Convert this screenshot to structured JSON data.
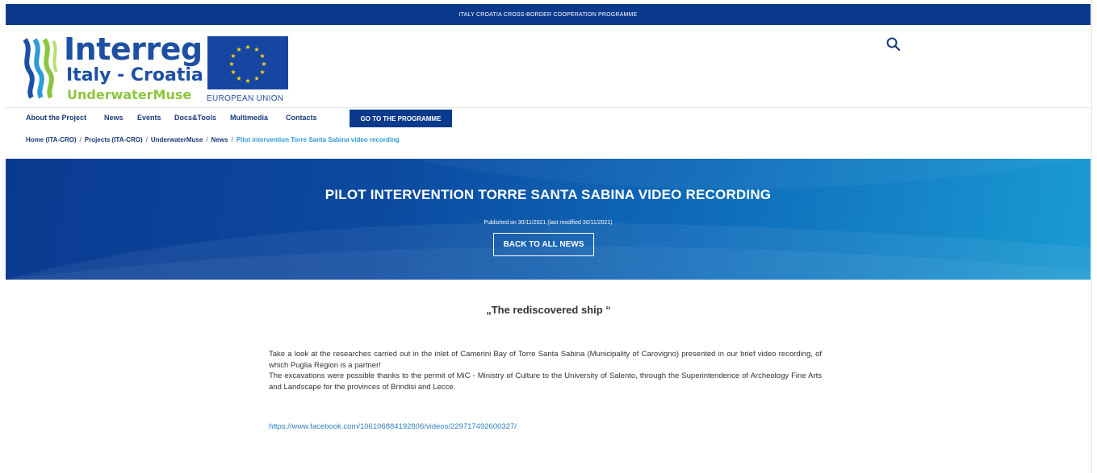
{
  "topbar": {
    "text": "ITALY CROATIA CROSS-BORDER COOPERATION PROGRAMME"
  },
  "logo": {
    "line1": "Interreg",
    "line2": "Italy - Croatia",
    "line3": "UnderwaterMuse",
    "eu_label": "EUROPEAN UNION",
    "colors": {
      "blue": "#1d4fa3",
      "green": "#8cc63f",
      "eu_flag": "#1746a2",
      "stars": "#ffdd00"
    }
  },
  "search": {
    "icon": "search-icon"
  },
  "nav": {
    "items": [
      "About the Project",
      "News",
      "Events",
      "Docs&Tools",
      "Multimedia",
      "Contacts"
    ],
    "program_button": "GO TO THE PROGRAMME"
  },
  "breadcrumb": {
    "items": [
      "Home (ITA-CRO)",
      "Projects (ITA-CRO)",
      "UnderwaterMuse",
      "News"
    ],
    "separator": "/",
    "current": "Pilot intervention Torre Santa Sabina video recording"
  },
  "hero": {
    "title": "PILOT INTERVENTION TORRE SANTA SABINA VIDEO RECORDING",
    "published": "Published on 30/11/2021 (last modified 30/11/2021)",
    "back_button": "BACK TO ALL NEWS"
  },
  "article": {
    "subtitle": "„The rediscovered ship “",
    "paragraph1": "Take a look at the researches carried out in the inlet of Camerini Bay of Torre Santa Sabina (Municipality of Carovigno) presented in our brief video recording, of which Puglia Region is a partner!",
    "paragraph2": "The excavations were possible thanks to the permit of MiC - Ministry of Culture to the University of Salento, through the Superintendence of Archeology Fine Arts and Landscape for the provinces of Brindisi and Lecce.",
    "link": "https://www.facebook.com/106106884192806/videos/229717492600327/"
  },
  "colors": {
    "primary": "#0b3a8d",
    "accent": "#2f9bd6",
    "link": "#2f7dc0"
  }
}
